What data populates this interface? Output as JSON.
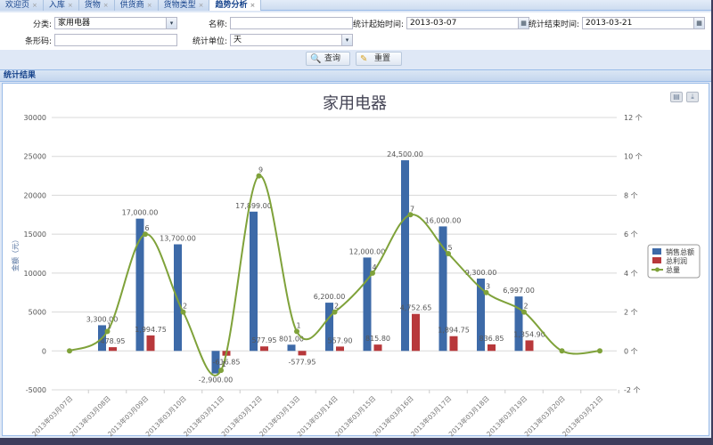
{
  "tabs": [
    {
      "label": "欢迎页"
    },
    {
      "label": "入库"
    },
    {
      "label": "货物"
    },
    {
      "label": "供货商"
    },
    {
      "label": "货物类型"
    },
    {
      "label": "趋势分析",
      "active": true
    }
  ],
  "form": {
    "category_label": "分类:",
    "category_value": "家用电器",
    "name_label": "名称:",
    "name_value": "",
    "start_label": "统计起始时间:",
    "start_value": "2013-03-07",
    "end_label": "统计结束时间:",
    "end_value": "2013-03-21",
    "barcode_label": "条形码:",
    "barcode_value": "",
    "unit_label": "统计单位:",
    "unit_value": "天",
    "query_label": "查询",
    "reset_label": "重置"
  },
  "section_title": "统计结果",
  "chart_data": {
    "type": "bar",
    "title": "家用电器",
    "ylabel": "金额（元）",
    "ylim": [
      -5000,
      30000
    ],
    "yticks": [
      "-5000",
      "0",
      "5000",
      "10000",
      "15000",
      "20000",
      "25000",
      "30000"
    ],
    "y2lim": [
      -2,
      12
    ],
    "y2ticks": [
      "-2 个",
      "0 个",
      "2 个",
      "4 个",
      "6 个",
      "8 个",
      "10 个",
      "12 个"
    ],
    "legend_position": "right",
    "categories": [
      "2013年03月07日",
      "2013年03月08日",
      "2013年03月09日",
      "2013年03月10日",
      "2013年03月11日",
      "2013年03月12日",
      "2013年03月13日",
      "2013年03月14日",
      "2013年03月15日",
      "2013年03月16日",
      "2013年03月17日",
      "2013年03月18日",
      "2013年03月19日",
      "2013年03月20日",
      "2013年03月21日"
    ],
    "series": [
      {
        "name": "销售总额",
        "type": "bar",
        "color": "#3d6aa8",
        "values": [
          0,
          3300,
          17000,
          13700,
          -2900,
          17899,
          801,
          6200,
          12000,
          24500,
          16000,
          9300,
          6997,
          0,
          0
        ],
        "labels": [
          "",
          "3,300.00",
          "17,000.00",
          "13,700.00",
          "-2,900.00",
          "17,899.00",
          "801.00",
          "6,200.00",
          "12,000.00",
          "24,500.00",
          "16,000.00",
          "9,300.00",
          "6,997.00",
          "",
          ""
        ]
      },
      {
        "name": "总利润",
        "type": "bar",
        "color": "#b8383b",
        "values": [
          0,
          478.95,
          1994.75,
          0,
          -616.85,
          577.95,
          -577.95,
          557.9,
          815.8,
          4752.65,
          1894.75,
          836.85,
          1354.9,
          0,
          0
        ],
        "labels": [
          "",
          "478.95",
          "1,994.75",
          "",
          "-616.85",
          "577.95",
          "-577.95",
          "557.90",
          "815.80",
          "4,752.65",
          "1,894.75",
          "836.85",
          "1,354.90",
          "",
          ""
        ]
      },
      {
        "name": "总量",
        "type": "spline",
        "axis": "right",
        "color": "#7fa23a",
        "values": [
          0,
          1,
          6,
          2,
          -1,
          9,
          1,
          2,
          4,
          7,
          5,
          3,
          2,
          0,
          0
        ]
      }
    ]
  }
}
